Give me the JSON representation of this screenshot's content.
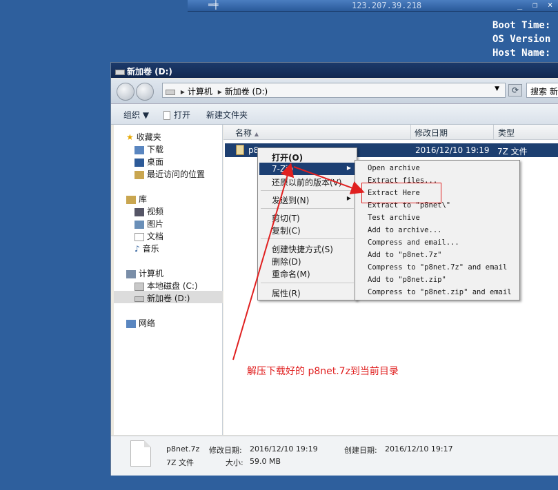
{
  "remote": {
    "ip": "123.207.39.218",
    "pin": "═╪",
    "minimize": "_",
    "restore": "❐",
    "close": "×"
  },
  "bginfo": {
    "line1": "Boot Time:",
    "line2": "OS Version",
    "line3": "Host Name:"
  },
  "window": {
    "title": "新加卷 (D:)"
  },
  "address": {
    "crumb1": "计算机",
    "crumb2": "新加卷 (D:)",
    "search_placeholder": "搜索 新"
  },
  "toolbar": {
    "organize": "组织 ▼",
    "open": "打开",
    "new_folder": "新建文件夹"
  },
  "nav": {
    "favorites": "收藏夹",
    "downloads": "下载",
    "desktop": "桌面",
    "recent": "最近访问的位置",
    "libraries": "库",
    "videos": "视频",
    "pictures": "图片",
    "documents": "文档",
    "music": "音乐",
    "computer": "计算机",
    "local_disk": "本地磁盘 (C:)",
    "new_volume": "新加卷 (D:)",
    "network": "网络"
  },
  "columns": {
    "name": "名称",
    "modified": "修改日期",
    "type": "类型"
  },
  "file": {
    "name_partial": "p8",
    "modified": "2016/12/10 19:19",
    "type": "7Z 文件"
  },
  "context_menu": {
    "open": "打开(O)",
    "sevenzip": "7-Zip",
    "restore": "还原以前的版本(V)",
    "send_to": "发送到(N)",
    "cut": "剪切(T)",
    "copy": "复制(C)",
    "shortcut": "创建快捷方式(S)",
    "delete": "删除(D)",
    "rename": "重命名(M)",
    "properties": "属性(R)"
  },
  "submenu": {
    "items": [
      "Open archive",
      "Extract files...",
      "Extract Here",
      "Extract to \"p8net\\\"",
      "Test archive",
      "Add to archive...",
      "Compress and email...",
      "Add to \"p8net.7z\"",
      "Compress to \"p8net.7z\" and email",
      "Add to \"p8net.zip\"",
      "Compress to \"p8net.zip\" and email"
    ]
  },
  "annotation": {
    "text": "解压下载好的 p8net.7z到当前目录",
    "color": "#e02020"
  },
  "details": {
    "filename": "p8net.7z",
    "modified_label": "修改日期:",
    "modified": "2016/12/10 19:19",
    "created_label": "创建日期:",
    "created": "2016/12/10 19:17",
    "type": "7Z 文件",
    "size_label": "大小:",
    "size": "59.0 MB"
  },
  "colors": {
    "desktop": "#2e5f9d",
    "selection": "#1c3f73"
  }
}
